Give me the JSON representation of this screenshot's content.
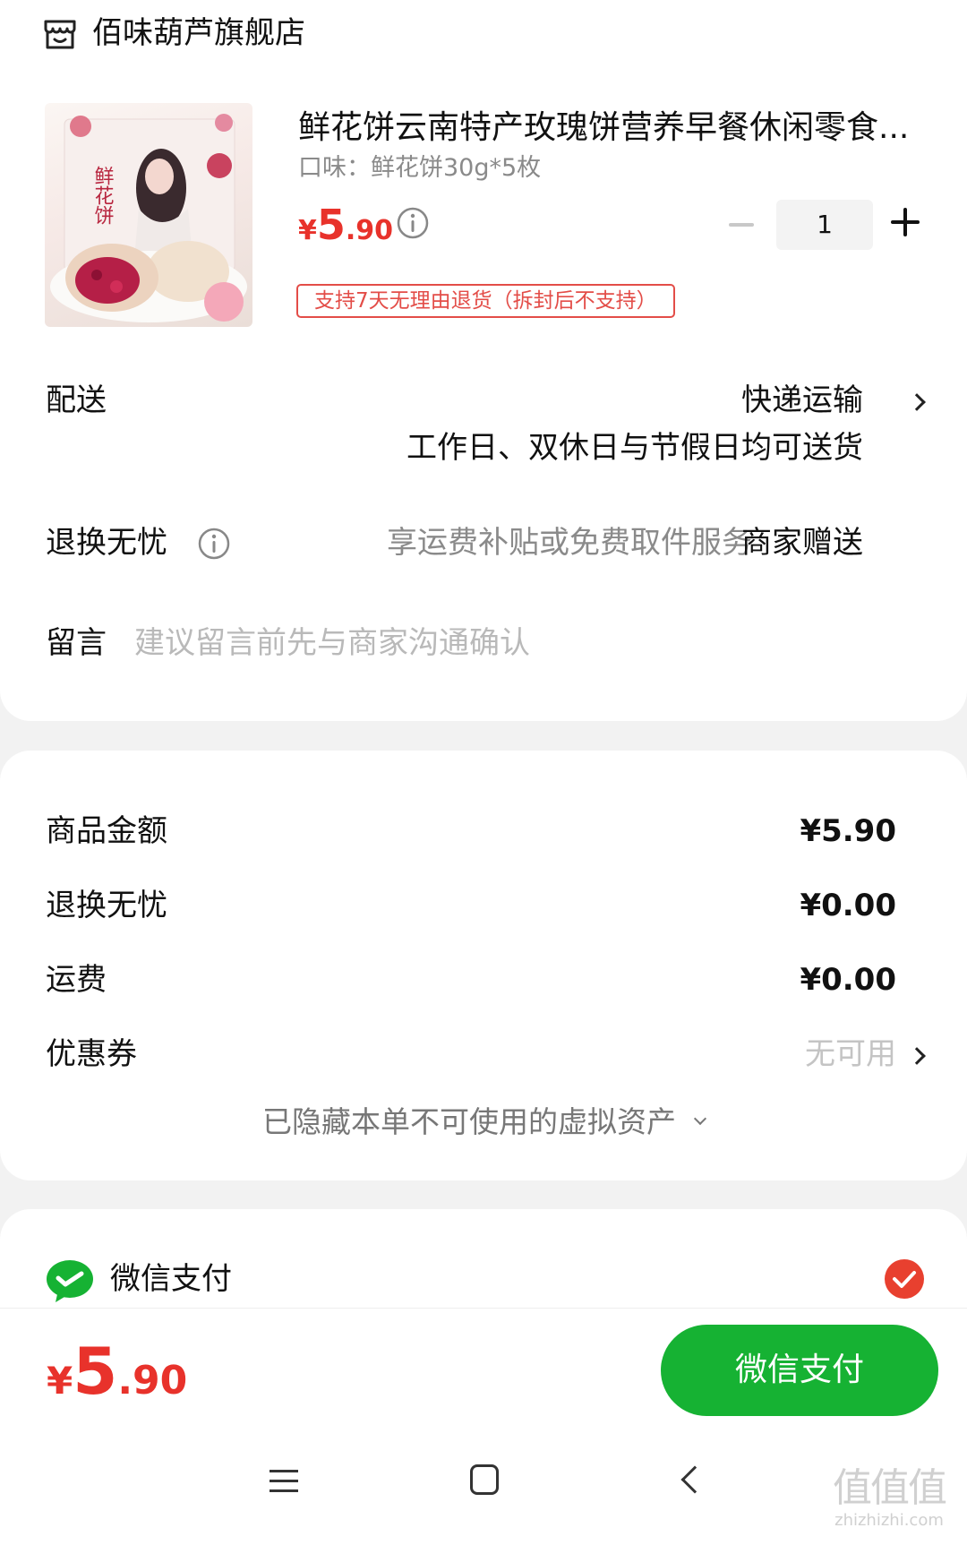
{
  "store": {
    "name": "佰味葫芦旗舰店",
    "icon": "store-icon"
  },
  "product": {
    "title": "鲜花饼云南特产玫瑰饼营养早餐休闲零食...",
    "spec": "口味：鲜花饼30g*5枚",
    "price_currency": "¥",
    "price_int": "5",
    "price_dec": ".90",
    "quantity": "1",
    "return_badge": "支持7天无理由退货（拆封后不支持）",
    "image_text": "鲜花饼"
  },
  "delivery": {
    "label": "配送",
    "method": "快递运输",
    "note": "工作日、双休日与节假日均可送货"
  },
  "returns": {
    "label": "退换无忧",
    "desc": "享运费补贴或免费取件服务",
    "gift": "商家赠送"
  },
  "message": {
    "label": "留言",
    "placeholder": "建议留言前先与商家沟通确认"
  },
  "summary": {
    "goods_label": "商品金额",
    "goods_value": "¥5.90",
    "returns_label": "退换无忧",
    "returns_value": "¥0.00",
    "shipping_label": "运费",
    "shipping_value": "¥0.00",
    "coupon_label": "优惠券",
    "coupon_value": "无可用",
    "hidden_assets": "已隐藏本单不可使用的虚拟资产"
  },
  "payment": {
    "method_label": "微信支付",
    "selected": true,
    "accent": "#16b233",
    "check_color": "#e8402f"
  },
  "footer": {
    "total_currency": "¥",
    "total_int": "5",
    "total_dec": ".90",
    "pay_button": "微信支付"
  },
  "watermark": {
    "logo": "值值值",
    "url": "zhizhizhi.com"
  },
  "colors": {
    "price_red": "#e8322b",
    "badge_red": "#e34d48",
    "pay_green": "#16b233",
    "background": "#f2f2f2"
  }
}
